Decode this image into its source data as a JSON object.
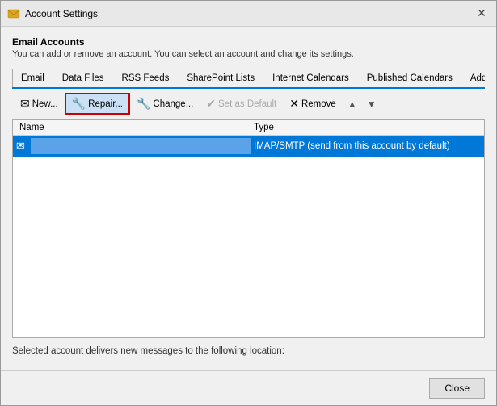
{
  "titleBar": {
    "title": "Account Settings",
    "closeIcon": "✕"
  },
  "emailAccounts": {
    "heading": "Email Accounts",
    "description": "You can add or remove an account. You can select an account and change its settings."
  },
  "tabs": [
    {
      "id": "email",
      "label": "Email",
      "active": true
    },
    {
      "id": "datafiles",
      "label": "Data Files",
      "active": false
    },
    {
      "id": "rssfeeds",
      "label": "RSS Feeds",
      "active": false
    },
    {
      "id": "sharepointlists",
      "label": "SharePoint Lists",
      "active": false
    },
    {
      "id": "internetcalendars",
      "label": "Internet Calendars",
      "active": false
    },
    {
      "id": "publishedcalendars",
      "label": "Published Calendars",
      "active": false
    },
    {
      "id": "addressbooks",
      "label": "Address Books",
      "active": false
    }
  ],
  "toolbar": {
    "newLabel": "New...",
    "repairLabel": "Repair...",
    "changeLabel": "Change...",
    "setDefaultLabel": "Set as Default",
    "removeLabel": "Remove",
    "upArrow": "▲",
    "downArrow": "▼"
  },
  "table": {
    "colName": "Name",
    "colType": "Type",
    "rows": [
      {
        "icon": "✉",
        "name": "",
        "type": "IMAP/SMTP (send from this account by default)",
        "selected": true
      }
    ]
  },
  "statusText": "Selected account delivers new messages to the following location:",
  "footer": {
    "closeLabel": "Close"
  }
}
